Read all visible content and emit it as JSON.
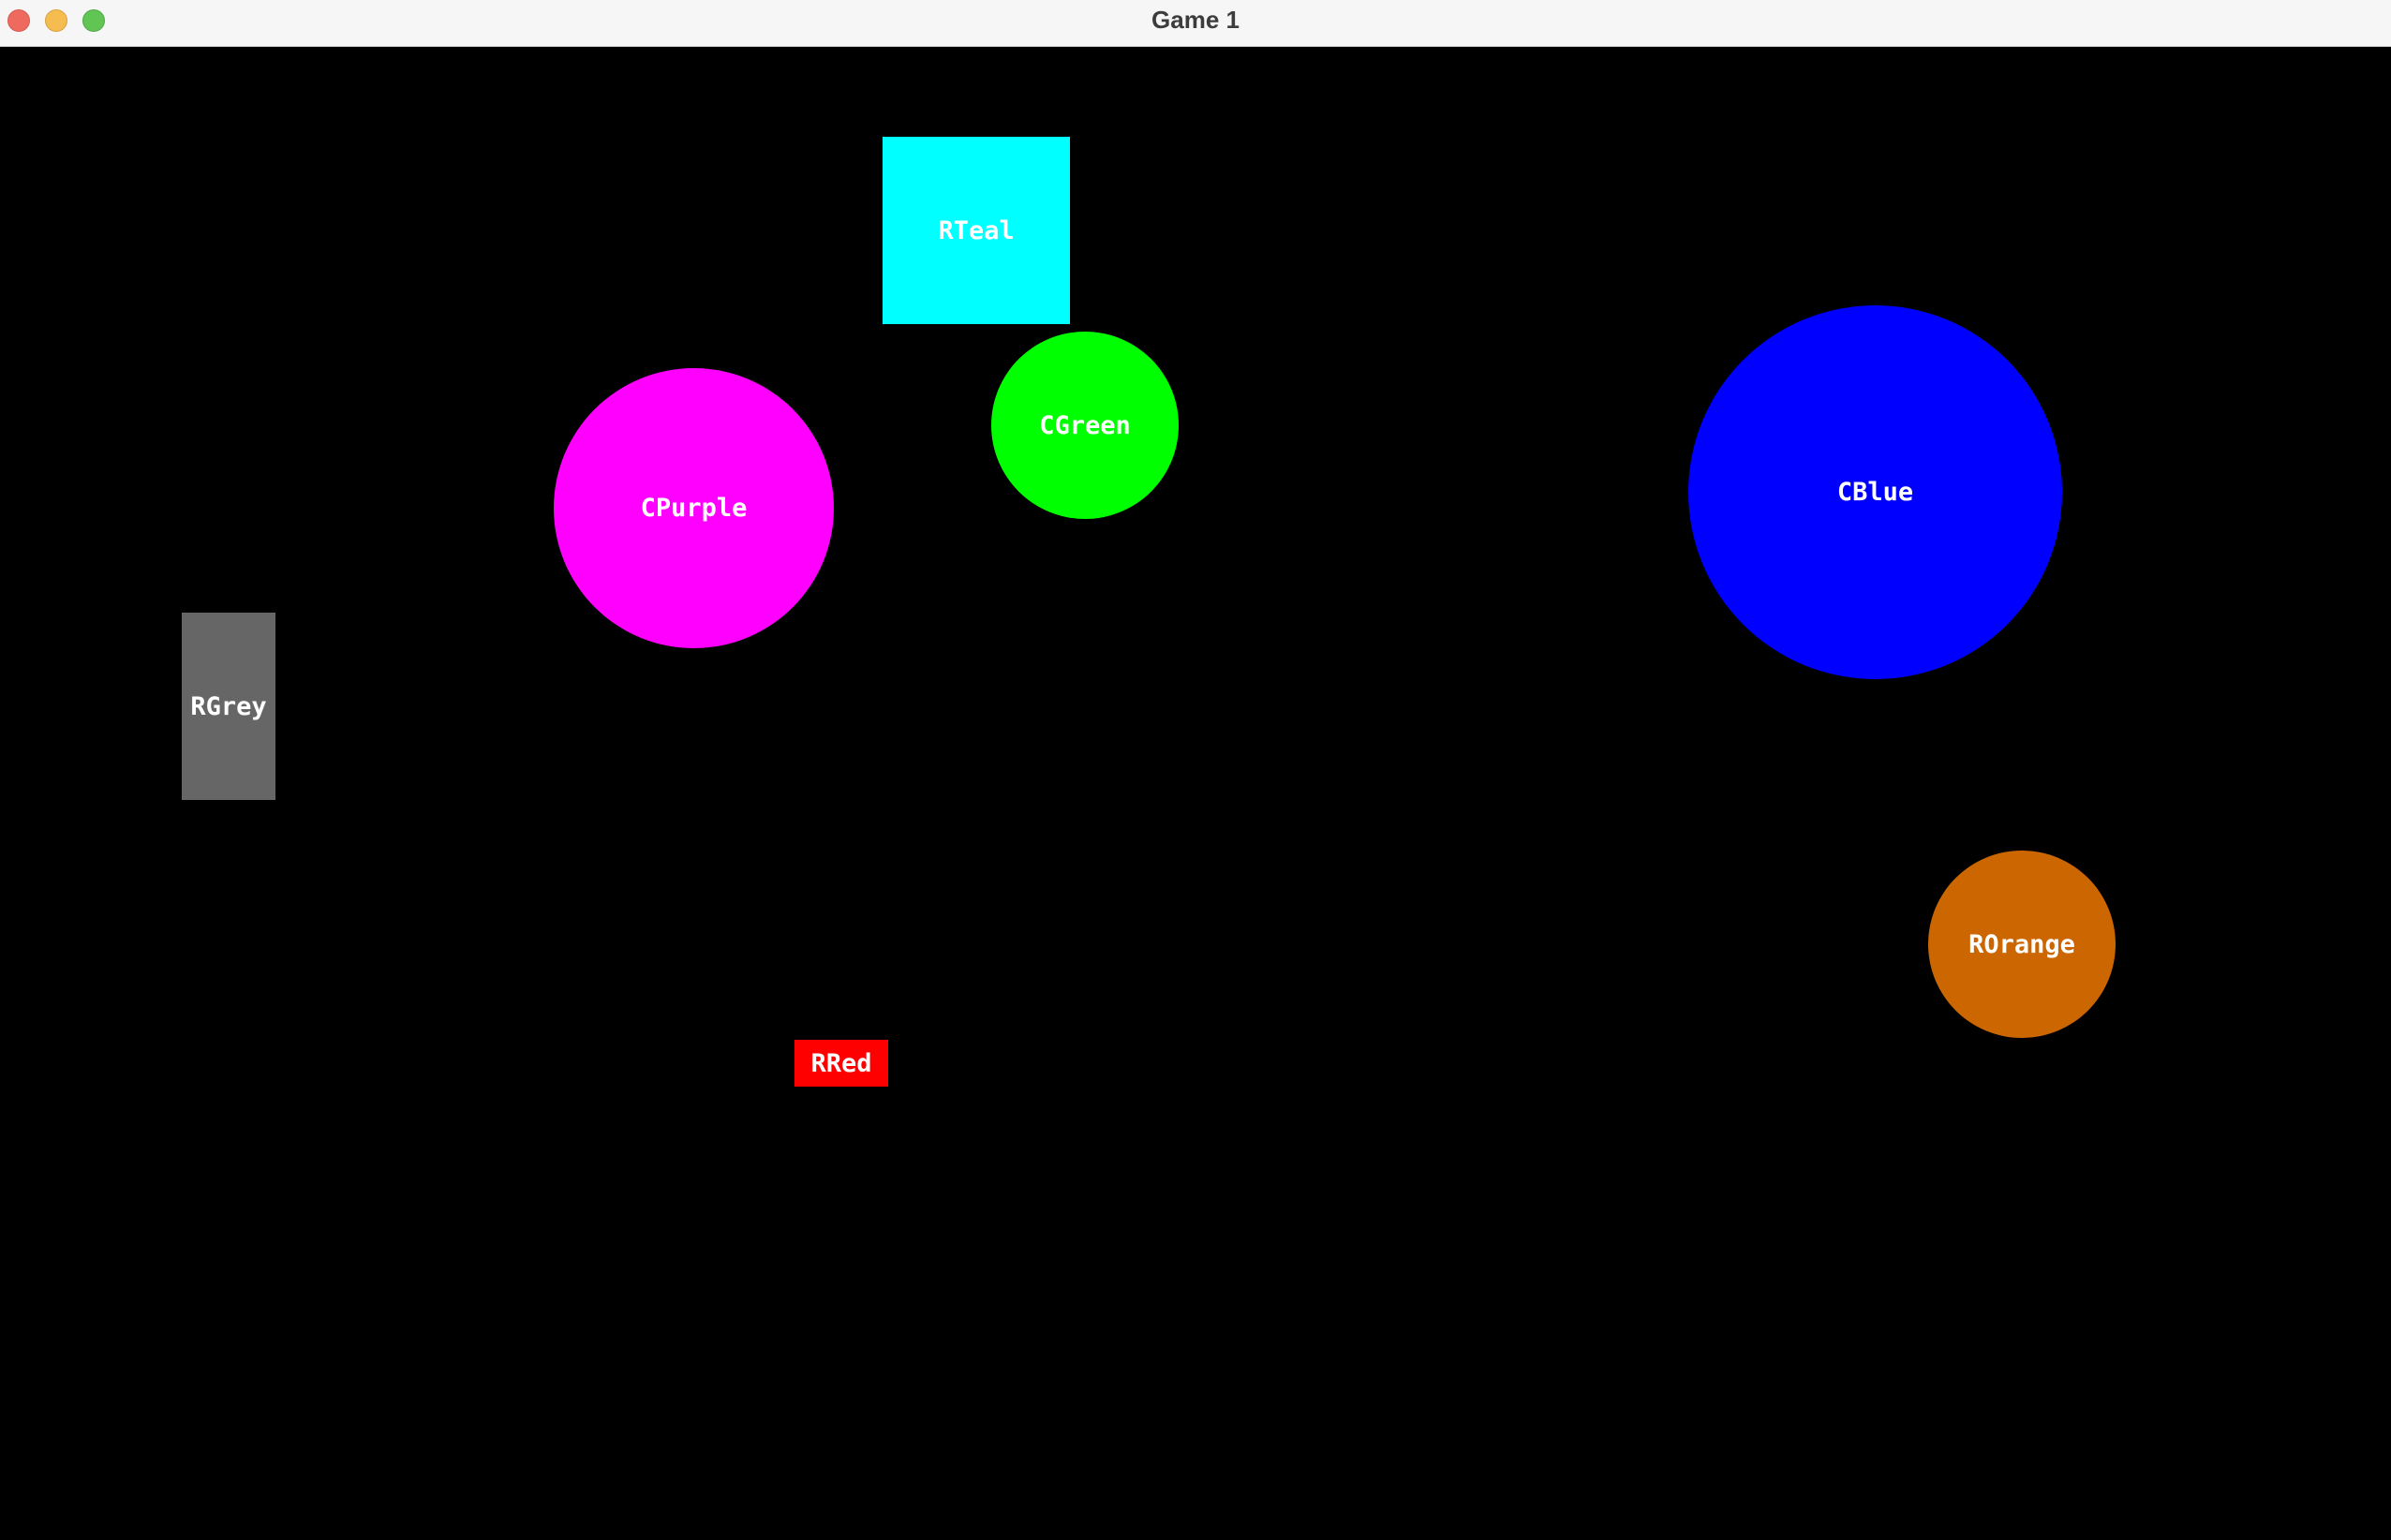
{
  "window": {
    "title": "Game 1"
  },
  "scene": {
    "background": "#000000",
    "shapes": [
      {
        "id": "teal",
        "kind": "rectangle",
        "label": "RTeal",
        "color": "#00ffff"
      },
      {
        "id": "green",
        "kind": "circle",
        "label": "CGreen",
        "color": "#00ff00"
      },
      {
        "id": "purple",
        "kind": "circle",
        "label": "CPurple",
        "color": "#ff00ff"
      },
      {
        "id": "blue",
        "kind": "circle",
        "label": "CBlue",
        "color": "#0000ff"
      },
      {
        "id": "grey",
        "kind": "rectangle",
        "label": "RGrey",
        "color": "#666666"
      },
      {
        "id": "orange",
        "kind": "circle",
        "label": "ROrange",
        "color": "#cc6600"
      },
      {
        "id": "red",
        "kind": "rectangle",
        "label": "RRed",
        "color": "#ff0000"
      }
    ]
  }
}
